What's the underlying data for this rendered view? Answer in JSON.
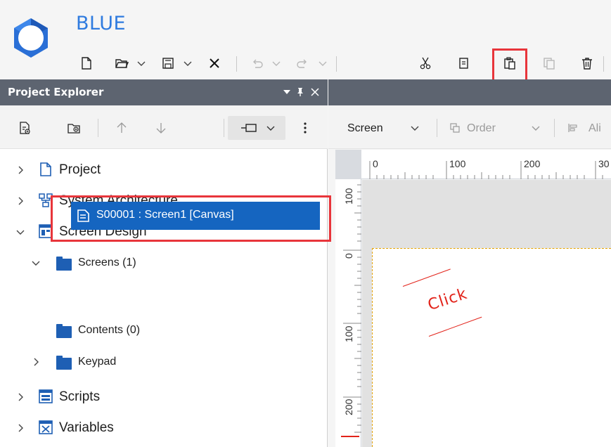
{
  "app": {
    "name": "BLUE"
  },
  "toolbar": {
    "buttons": [
      {
        "name": "new-file-icon"
      },
      {
        "name": "open-folder-icon"
      },
      {
        "name": "save-icon"
      },
      {
        "name": "close-icon"
      },
      {
        "name": "undo-icon"
      },
      {
        "name": "redo-icon"
      },
      {
        "name": "cut-icon"
      },
      {
        "name": "copy-icon"
      },
      {
        "name": "paste-icon",
        "highlighted": true
      },
      {
        "name": "duplicate-icon"
      },
      {
        "name": "delete-icon"
      }
    ]
  },
  "project_explorer": {
    "title": "Project Explorer",
    "header_buttons": [
      "dropdown-icon",
      "pin-icon",
      "close-icon"
    ],
    "toolbar": [
      "add-item-icon",
      "add-folder-icon",
      "move-up-icon",
      "move-down-icon",
      "expand-collapse-icon",
      "more-options-icon"
    ],
    "tree": {
      "project": "Project",
      "system_architecture": "System Architecture",
      "screen_design": "Screen Design",
      "screens": "Screens (1)",
      "screen1": "S00001 : Screen1 [Canvas]",
      "contents": "Contents (0)",
      "keypad": "Keypad",
      "scripts": "Scripts",
      "variables": "Variables"
    }
  },
  "editor": {
    "screen_dropdown": "Screen",
    "order_label": "Order",
    "align_label": "Ali",
    "ruler_h": [
      "0",
      "100",
      "200",
      "30"
    ],
    "ruler_v": [
      "100",
      "0",
      "100",
      "200"
    ],
    "annotation": "Click"
  },
  "colors": {
    "accent": "#2f7bdf",
    "selection": "#1565c0",
    "highlight": "#e8353b",
    "header": "#5d6470"
  }
}
